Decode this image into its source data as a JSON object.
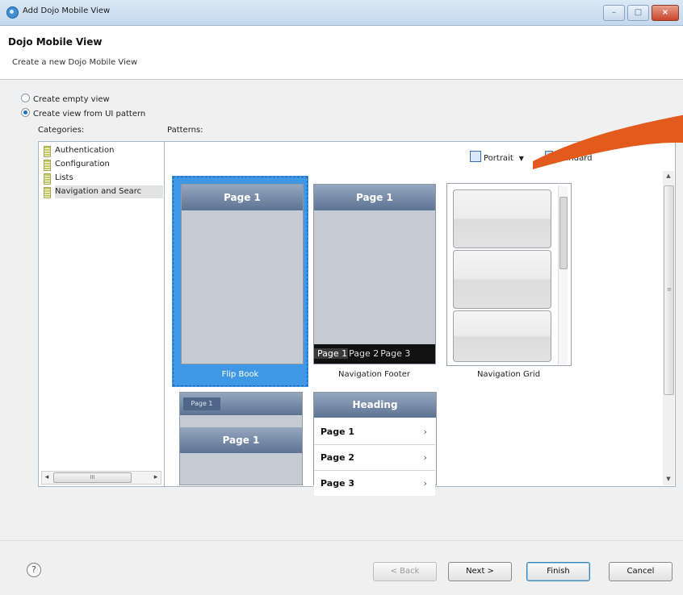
{
  "window": {
    "title": "Add Dojo Mobile View",
    "controls": [
      "–",
      "□",
      "×"
    ]
  },
  "header": {
    "title": "Dojo Mobile View",
    "subtitle": "Create a new Dojo Mobile View"
  },
  "options": {
    "empty": {
      "label": "Create empty view",
      "selected": false
    },
    "pattern": {
      "label": "Create view from UI pattern",
      "selected": true
    }
  },
  "categories": {
    "label": "Categories:",
    "items": [
      "Authentication",
      "Configuration",
      "Lists",
      "Navigation and Searc"
    ],
    "selected_index": 3,
    "scroll_left": "◂",
    "scroll_right": "▸",
    "scroll_grip": "III"
  },
  "patterns": {
    "label": "Patterns:",
    "orientation": "Portrait",
    "size": "Standard",
    "cards": [
      {
        "name": "Flip Book",
        "heading": "Page 1"
      },
      {
        "name": "Navigation Footer",
        "heading": "Page 1",
        "footer": [
          "Page 1",
          "Page 2",
          "Page 3"
        ]
      },
      {
        "name": "Navigation Grid"
      }
    ],
    "partial_cards": [
      {
        "tab": "Page 1",
        "heading": "Page 1"
      },
      {
        "heading": "Heading",
        "rows": [
          "Page 1",
          "Page 2",
          "Page 3"
        ]
      }
    ]
  },
  "buttons": {
    "help": "?",
    "back": "< Back",
    "next": "Next >",
    "finish": "Finish",
    "cancel": "Cancel"
  },
  "colors": {
    "selection": "#3f98e6",
    "header_bar": "#5d7393",
    "accent_arrow": "#e25a1c"
  }
}
